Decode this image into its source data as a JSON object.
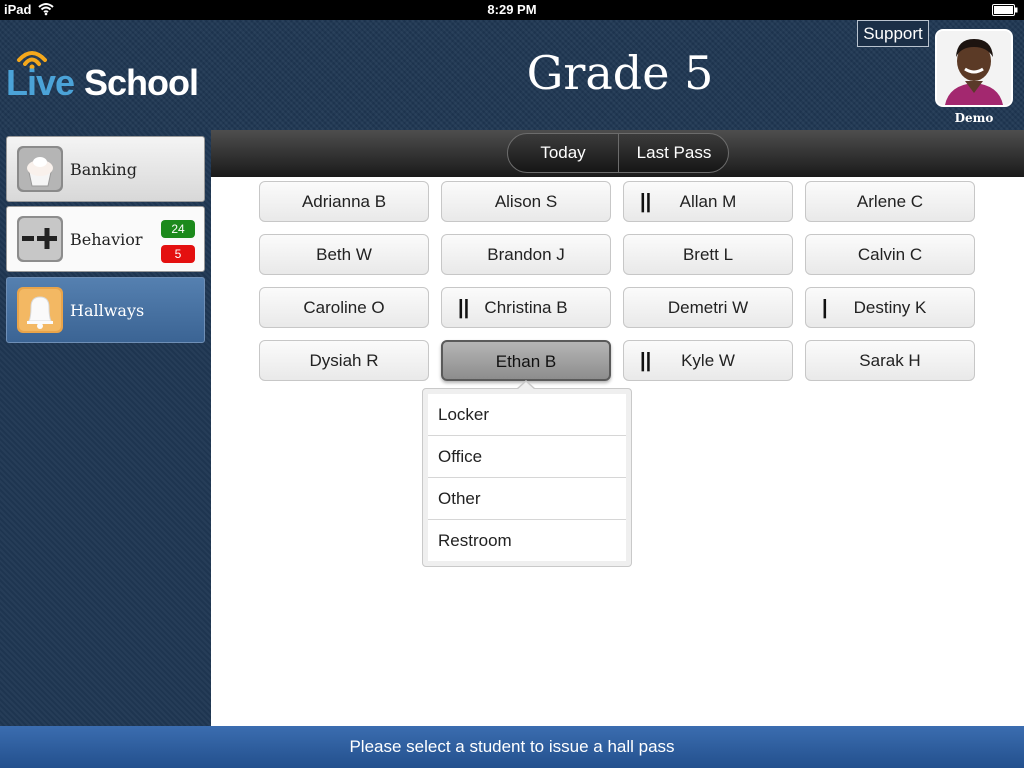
{
  "status_bar": {
    "device": "iPad",
    "time": "8:29 PM"
  },
  "header": {
    "logo_part1": "Live",
    "logo_part2": "School",
    "title": "Grade 5",
    "support_label": "Support",
    "user_name": "Demo"
  },
  "sidebar": {
    "items": [
      {
        "label": "Banking",
        "icon": "cupcake-icon"
      },
      {
        "label": "Behavior",
        "icon": "plus-minus-icon",
        "positive_count": "24",
        "negative_count": "5"
      },
      {
        "label": "Hallways",
        "icon": "bell-icon"
      }
    ]
  },
  "toolbar": {
    "segments": [
      "Today",
      "Last Pass"
    ]
  },
  "students": [
    {
      "name": "Adrianna B",
      "tally": ""
    },
    {
      "name": "Alison S",
      "tally": ""
    },
    {
      "name": "Allan M",
      "tally": "||"
    },
    {
      "name": "Arlene C",
      "tally": ""
    },
    {
      "name": "Beth W",
      "tally": ""
    },
    {
      "name": "Brandon J",
      "tally": ""
    },
    {
      "name": "Brett L",
      "tally": ""
    },
    {
      "name": "Calvin C",
      "tally": ""
    },
    {
      "name": "Caroline O",
      "tally": ""
    },
    {
      "name": "Christina B",
      "tally": "||"
    },
    {
      "name": "Demetri W",
      "tally": ""
    },
    {
      "name": "Destiny K",
      "tally": "|"
    },
    {
      "name": "Dysiah R",
      "tally": ""
    },
    {
      "name": "Ethan B",
      "tally": ""
    },
    {
      "name": "Kyle W",
      "tally": "||"
    },
    {
      "name": "Sarak H",
      "tally": ""
    }
  ],
  "selected_student": "Ethan B",
  "pass_menu": {
    "options": [
      "Locker",
      "Office",
      "Other",
      "Restroom"
    ]
  },
  "footer": {
    "message": "Please select a student to issue a hall pass"
  },
  "colors": {
    "header_bg": "#1f3753",
    "footer_bg": "#2d5f9f",
    "positive_badge": "#1c8a1c",
    "negative_badge": "#e41010",
    "logo_live": "#4ba3d8",
    "signal": "#f4a81c"
  }
}
